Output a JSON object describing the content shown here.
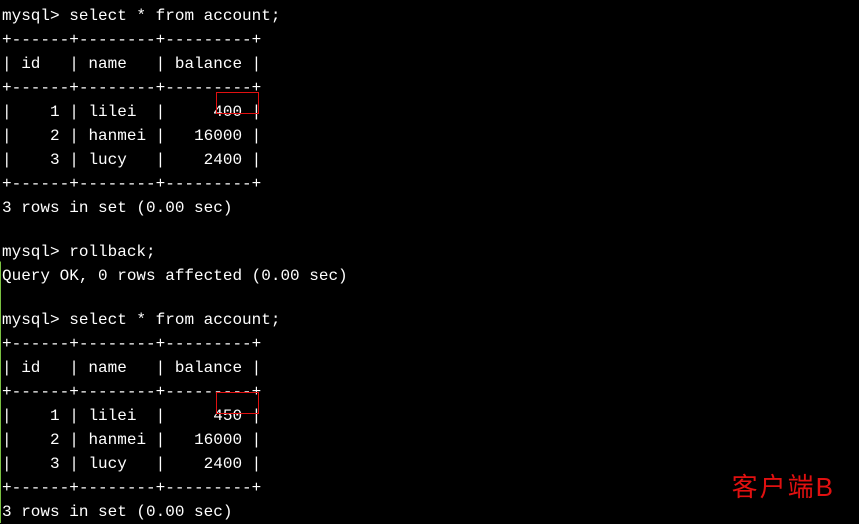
{
  "prompt": "mysql>",
  "queries": {
    "q1": "select * from account;",
    "q2": "rollback;",
    "q3": "select * from account;"
  },
  "responses": {
    "rows_in_set": "3 rows in set (0.00 sec)",
    "query_ok": "Query OK, 0 rows affected (0.00 sec)"
  },
  "table_border": "+------+--------+---------+",
  "table_header": {
    "col1": "id",
    "col2": "name",
    "col3": "balance"
  },
  "result1": {
    "rows": [
      {
        "id": "1",
        "name": "lilei",
        "balance": "400"
      },
      {
        "id": "2",
        "name": "hanmei",
        "balance": "16000"
      },
      {
        "id": "3",
        "name": "lucy",
        "balance": "2400"
      }
    ]
  },
  "result2": {
    "rows": [
      {
        "id": "1",
        "name": "lilei",
        "balance": "450"
      },
      {
        "id": "2",
        "name": "hanmei",
        "balance": "16000"
      },
      {
        "id": "3",
        "name": "lucy",
        "balance": "2400"
      }
    ]
  },
  "client_label": "客户端B",
  "chart_data": {
    "type": "table",
    "title": "MySQL account table before and after rollback (Client B)",
    "columns": [
      "id",
      "name",
      "balance"
    ],
    "before_rollback": [
      {
        "id": 1,
        "name": "lilei",
        "balance": 400
      },
      {
        "id": 2,
        "name": "hanmei",
        "balance": 16000
      },
      {
        "id": 3,
        "name": "lucy",
        "balance": 2400
      }
    ],
    "after_rollback": [
      {
        "id": 1,
        "name": "lilei",
        "balance": 450
      },
      {
        "id": 2,
        "name": "hanmei",
        "balance": 16000
      },
      {
        "id": 3,
        "name": "lucy",
        "balance": 2400
      }
    ],
    "highlighted_values": [
      400,
      450
    ]
  }
}
